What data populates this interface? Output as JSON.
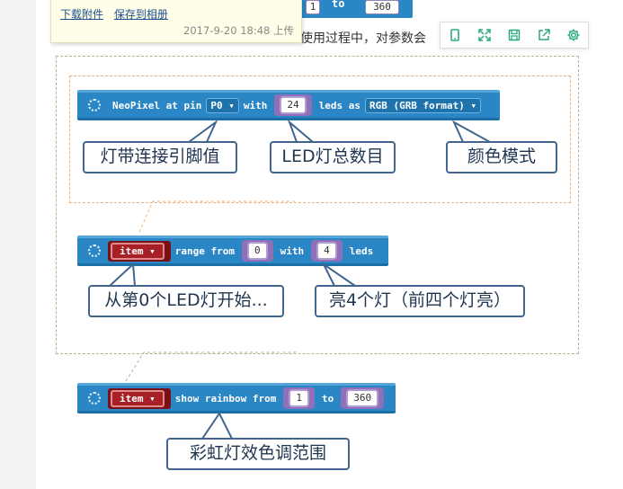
{
  "tooltip": {
    "links": [
      "下载附件",
      "保存到相册"
    ],
    "meta": "2017-9-20 18:48 上传"
  },
  "body_text": "使用过程中，对参数会",
  "top_block": {
    "a": "1",
    "to": "to",
    "b": "360"
  },
  "toolbar_icons": [
    "tablet-icon",
    "expand-icon",
    "save-icon",
    "share-icon",
    "gear-icon"
  ],
  "block1": {
    "prefix": "NeoPixel at pin",
    "pin": "P0 ▾",
    "with": "with",
    "count": "24",
    "leds_as": "leds as",
    "format": "RGB (GRB format) ▾"
  },
  "block2": {
    "var": "item ▾",
    "range_from": "range from",
    "start": "0",
    "with": "with",
    "count": "4",
    "leds": "leds"
  },
  "block3": {
    "var": "item ▾",
    "show_rainbow": "show rainbow from",
    "from": "1",
    "to": "to",
    "end": "360"
  },
  "callouts": {
    "pin": "灯带连接引脚值",
    "total": "LED灯总数目",
    "color_mode": "颜色模式",
    "start_from": "从第0个LED灯开始...",
    "light4": "亮4个灯（前四个灯亮）",
    "rainbow": "彩虹灯效色调范围"
  },
  "colors": {
    "block": "#2a86c4",
    "callout_border": "#40668f",
    "variable": "#a62025",
    "number_border": "#b39ccf"
  }
}
